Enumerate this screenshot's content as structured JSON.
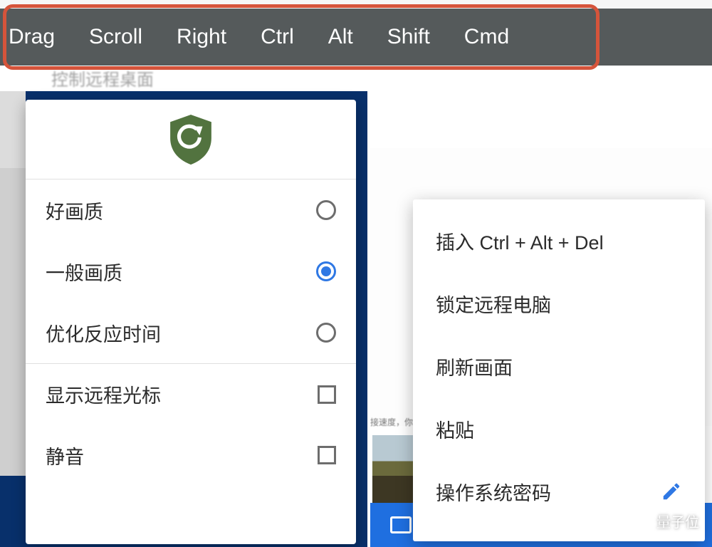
{
  "toolbar": {
    "buttons": [
      "Drag",
      "Scroll",
      "Right",
      "Ctrl",
      "Alt",
      "Shift",
      "Cmd"
    ]
  },
  "under_text": "控制远程桌面",
  "quality_panel": {
    "icon": "shield-refresh-icon",
    "options": [
      {
        "label": "好画质",
        "kind": "radio",
        "selected": false
      },
      {
        "label": "一般画质",
        "kind": "radio",
        "selected": true
      },
      {
        "label": "优化反应时间",
        "kind": "radio",
        "selected": false
      }
    ],
    "toggles": [
      {
        "label": "显示远程光标",
        "checked": false
      },
      {
        "label": "静音",
        "checked": false
      }
    ]
  },
  "context_menu": {
    "items": [
      {
        "label": "插入 Ctrl + Alt + Del",
        "trailing": null
      },
      {
        "label": "锁定远程电脑",
        "trailing": null
      },
      {
        "label": "刷新画面",
        "trailing": null
      },
      {
        "label": "粘贴",
        "trailing": null
      },
      {
        "label": "操作系统密码",
        "trailing": "pencil-icon"
      }
    ]
  },
  "right_bg_text": "接速度，你",
  "watermark": "量子位"
}
